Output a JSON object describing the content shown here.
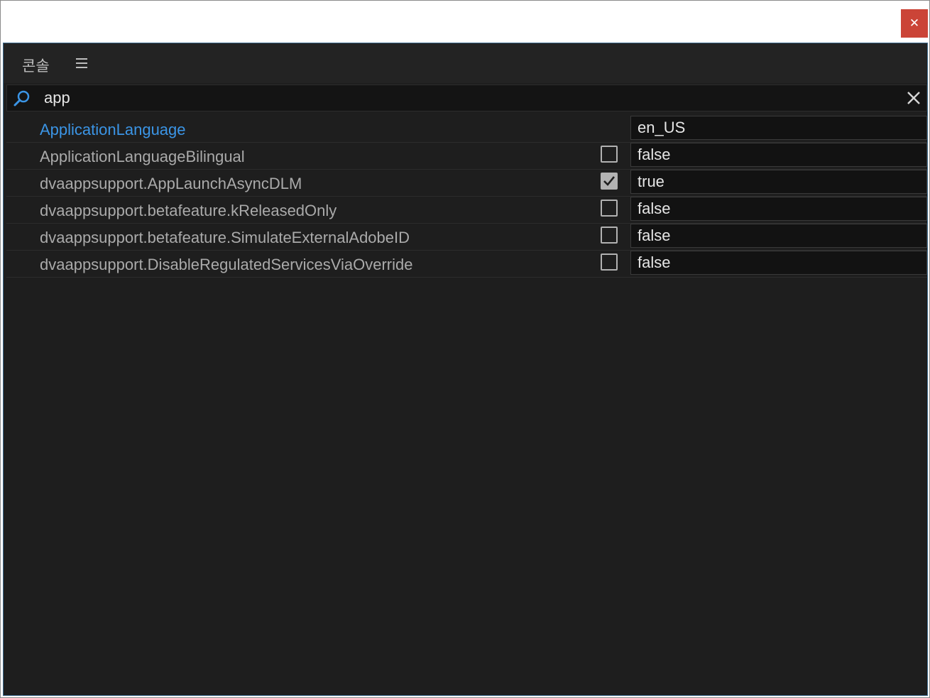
{
  "window": {
    "close_label": "✕"
  },
  "panel": {
    "title": "콘솔",
    "menu_icon": "hamburger-menu-icon"
  },
  "search": {
    "value": "app",
    "icon": "search-icon",
    "clear_icon": "clear-icon"
  },
  "colors": {
    "panel_bg": "#1e1e1e",
    "accent": "#3b95e6",
    "close_bg": "#c42b1c"
  },
  "rows": [
    {
      "name": "ApplicationLanguage",
      "has_checkbox": false,
      "checked": false,
      "value": "en_US",
      "selected": true
    },
    {
      "name": "ApplicationLanguageBilingual",
      "has_checkbox": true,
      "checked": false,
      "value": "false",
      "selected": false
    },
    {
      "name": "dvaappsupport.AppLaunchAsyncDLM",
      "has_checkbox": true,
      "checked": true,
      "value": "true",
      "selected": false
    },
    {
      "name": "dvaappsupport.betafeature.kReleasedOnly",
      "has_checkbox": true,
      "checked": false,
      "value": "false",
      "selected": false
    },
    {
      "name": "dvaappsupport.betafeature.SimulateExternalAdobeID",
      "has_checkbox": true,
      "checked": false,
      "value": "false",
      "selected": false
    },
    {
      "name": "dvaappsupport.DisableRegulatedServicesViaOverride",
      "has_checkbox": true,
      "checked": false,
      "value": "false",
      "selected": false
    }
  ]
}
